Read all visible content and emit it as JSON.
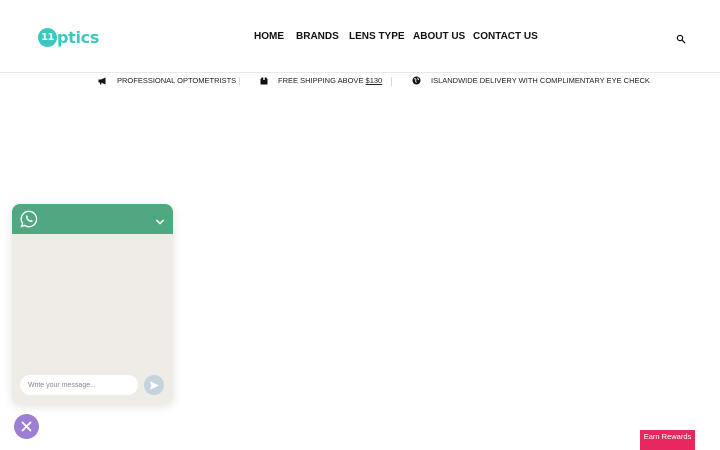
{
  "header": {
    "logo": {
      "badge": "11",
      "text": "ptics",
      "color": "#3ec7c0"
    },
    "nav": [
      {
        "label": "HOME"
      },
      {
        "label": "BRANDS"
      },
      {
        "label": "LENS TYPE"
      },
      {
        "label": "ABOUT US"
      },
      {
        "label": "CONTACT US"
      }
    ],
    "search_icon": "search-icon"
  },
  "promo": {
    "item1": {
      "icon": "megaphone-icon",
      "text": "PROFESSIONAL OPTOMETRISTS"
    },
    "item2": {
      "icon": "box-icon",
      "text_before": "FREE SHIPPING ABOVE ",
      "amount": "$130"
    },
    "item3": {
      "icon": "globe-icon",
      "text": "ISLANDWIDE DELIVERY WITH COMPLIMENTARY EYE CHECK"
    }
  },
  "whatsapp": {
    "header_color": "#4fa87f",
    "logo_icon": "whatsapp-icon",
    "collapse_icon": "chevron-down-icon",
    "input_placeholder": "Write your message...",
    "send_icon": "send-icon",
    "close_icon": "close-icon",
    "close_color": "#9c7fd3"
  },
  "rewards": {
    "label": "Earn Rewards",
    "color": "#e8275f"
  }
}
